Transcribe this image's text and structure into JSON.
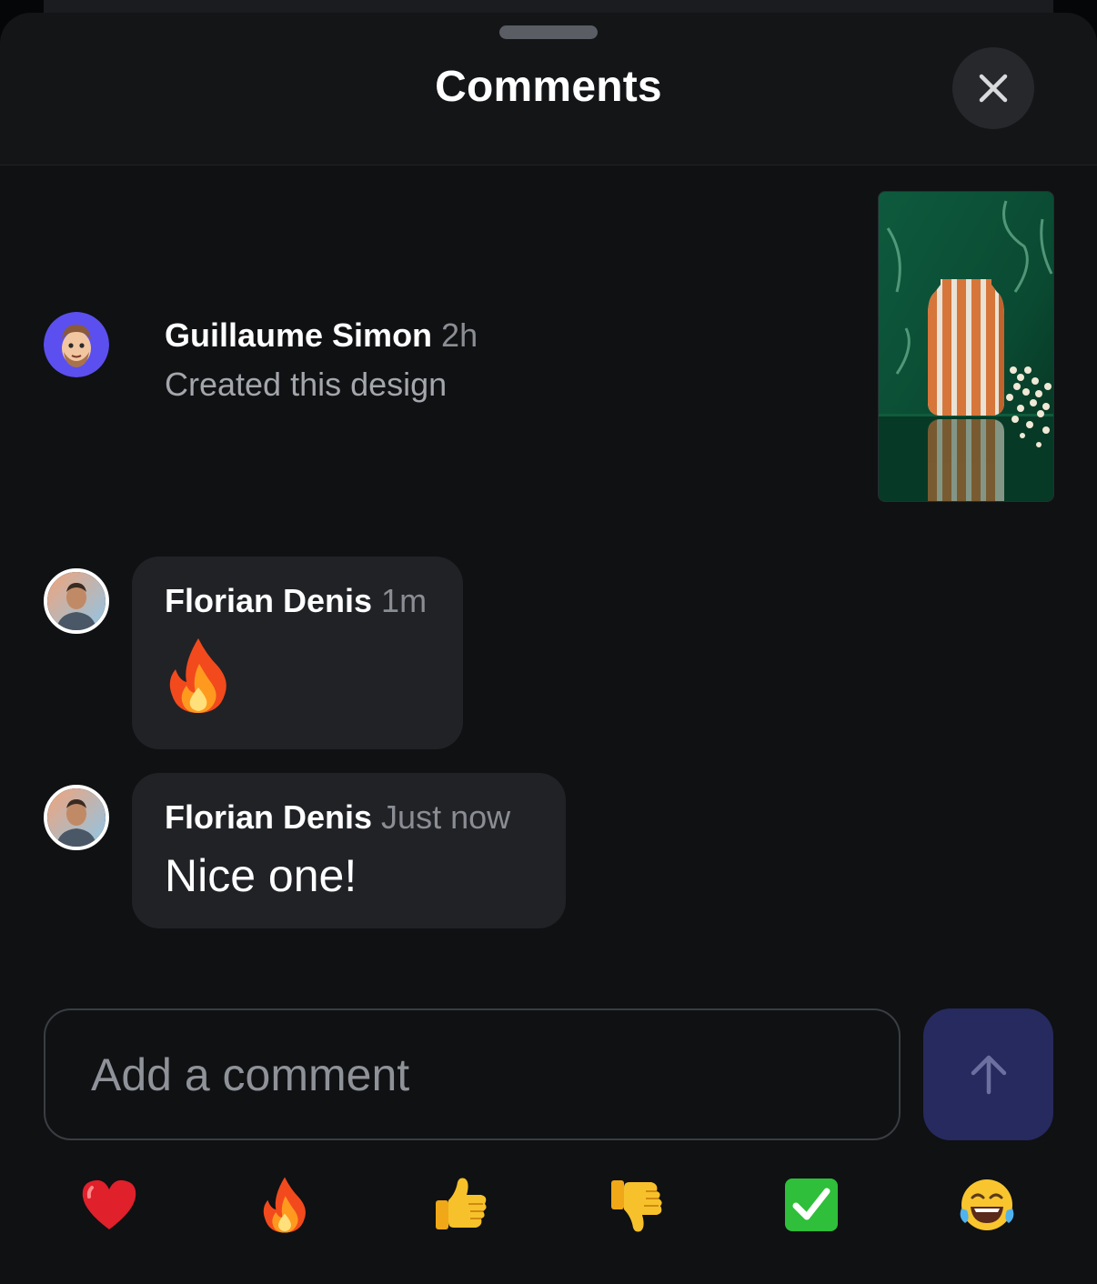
{
  "header": {
    "title": "Comments"
  },
  "activity": {
    "author": "Guillaume Simon",
    "time": "2h",
    "text": "Created this design"
  },
  "comments": [
    {
      "author": "Florian Denis",
      "time": "1m",
      "text": "🔥"
    },
    {
      "author": "Florian Denis",
      "time": "Just now",
      "text": "Nice one!"
    }
  ],
  "composer": {
    "placeholder": "Add a comment"
  },
  "reactions": [
    "heart-icon",
    "fire-icon",
    "thumbs-up-icon",
    "thumbs-down-icon",
    "check-mark-icon",
    "laughing-icon"
  ],
  "colors": {
    "accent": "#262a5e",
    "bubble": "#202226",
    "background": "#0f1113"
  }
}
